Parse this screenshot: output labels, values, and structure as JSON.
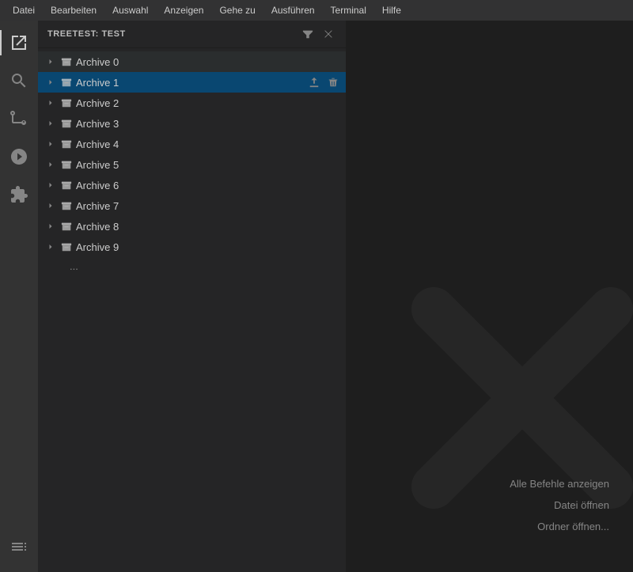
{
  "menubar": {
    "items": [
      {
        "label": "Datei",
        "id": "file"
      },
      {
        "label": "Bearbeiten",
        "id": "edit"
      },
      {
        "label": "Auswahl",
        "id": "selection"
      },
      {
        "label": "Anzeigen",
        "id": "view"
      },
      {
        "label": "Gehe zu",
        "id": "goto"
      },
      {
        "label": "Ausführen",
        "id": "run"
      },
      {
        "label": "Terminal",
        "id": "terminal"
      },
      {
        "label": "Hilfe",
        "id": "help"
      }
    ]
  },
  "activityBar": {
    "icons": [
      {
        "name": "explorer-icon",
        "tooltip": "Explorer"
      },
      {
        "name": "search-icon",
        "tooltip": "Search"
      },
      {
        "name": "source-control-icon",
        "tooltip": "Source Control"
      },
      {
        "name": "run-debug-icon",
        "tooltip": "Run and Debug"
      },
      {
        "name": "extensions-icon",
        "tooltip": "Extensions"
      },
      {
        "name": "outline-icon",
        "tooltip": "Outline"
      }
    ]
  },
  "panel": {
    "title": "TREETEST: TEST",
    "filterLabel": "Filter",
    "closeLabel": "Close"
  },
  "treeItems": [
    {
      "label": "Archive 0",
      "id": "archive-0",
      "hovered": false,
      "selected": false
    },
    {
      "label": "Archive 1",
      "id": "archive-1",
      "hovered": true,
      "selected": false
    },
    {
      "label": "Archive 2",
      "id": "archive-2",
      "hovered": false,
      "selected": false
    },
    {
      "label": "Archive 3",
      "id": "archive-3",
      "hovered": false,
      "selected": false
    },
    {
      "label": "Archive 4",
      "id": "archive-4",
      "hovered": false,
      "selected": false
    },
    {
      "label": "Archive 5",
      "id": "archive-5",
      "hovered": false,
      "selected": false
    },
    {
      "label": "Archive 6",
      "id": "archive-6",
      "hovered": false,
      "selected": false
    },
    {
      "label": "Archive 7",
      "id": "archive-7",
      "hovered": false,
      "selected": false
    },
    {
      "label": "Archive 8",
      "id": "archive-8",
      "hovered": false,
      "selected": false
    },
    {
      "label": "Archive 9",
      "id": "archive-9",
      "hovered": false,
      "selected": false
    }
  ],
  "ellipsis": "...",
  "editorActions": [
    {
      "label": "Alle Befehle anzeigen",
      "id": "show-commands"
    },
    {
      "label": "Datei öffnen",
      "id": "open-file"
    },
    {
      "label": "Ordner öffnen...",
      "id": "open-folder"
    }
  ]
}
